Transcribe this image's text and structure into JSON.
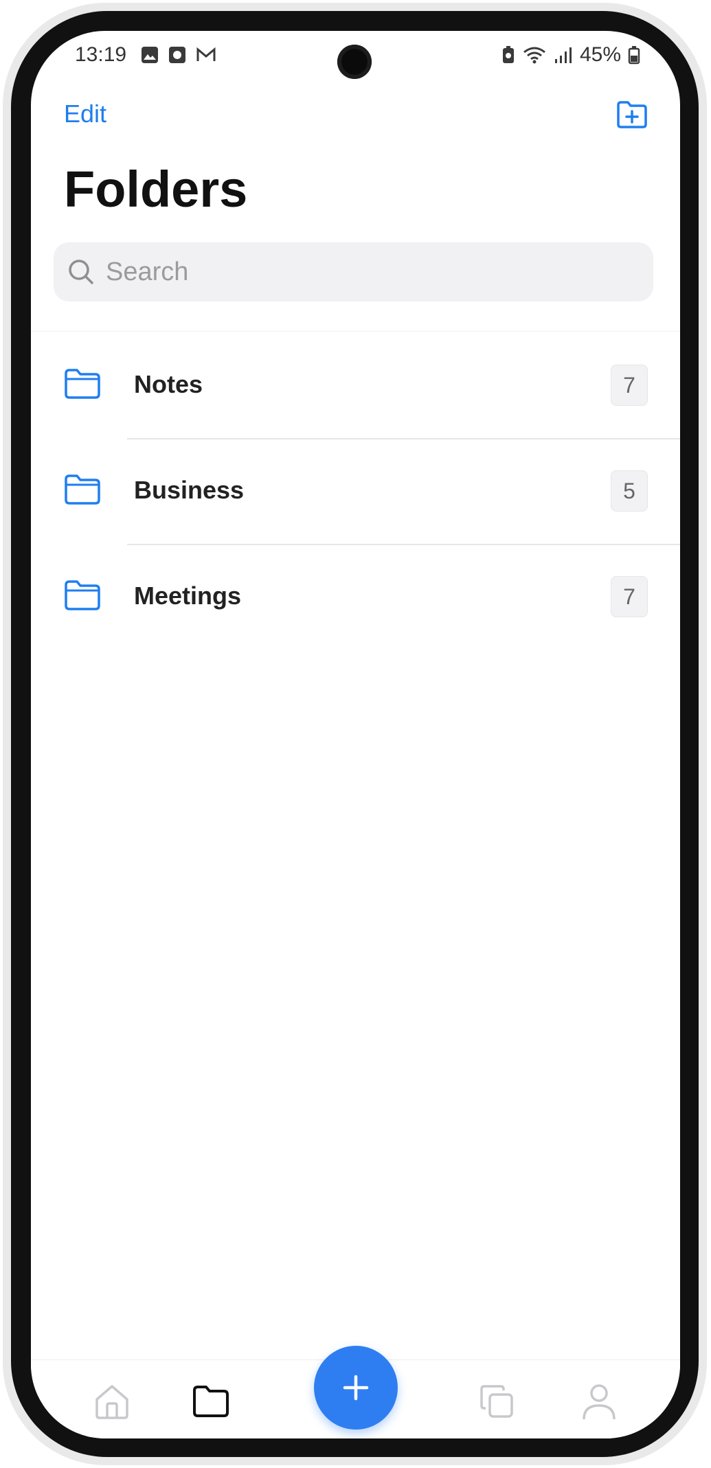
{
  "status_bar": {
    "time": "13:19",
    "left_icons": [
      "gallery-icon",
      "record-icon",
      "gmail-icon"
    ],
    "right_icons": [
      "battery-saver-icon",
      "wifi-icon",
      "signal-icon"
    ],
    "battery": "45%"
  },
  "header": {
    "edit_label": "Edit",
    "add_folder_icon": "folder-plus-icon"
  },
  "page": {
    "title": "Folders"
  },
  "search": {
    "placeholder": "Search",
    "value": ""
  },
  "folders": [
    {
      "name": "Notes",
      "count": "7"
    },
    {
      "name": "Business",
      "count": "5"
    },
    {
      "name": "Meetings",
      "count": "7"
    }
  ],
  "tab_bar": {
    "tabs": [
      "home-icon",
      "folder-icon",
      "copy-icon",
      "profile-icon"
    ],
    "active_tab": "folder-icon",
    "fab_icon": "plus-icon"
  },
  "colors": {
    "accent": "#1e7ef0",
    "fab": "#2f7ef1",
    "search_bg": "#f1f1f3"
  }
}
